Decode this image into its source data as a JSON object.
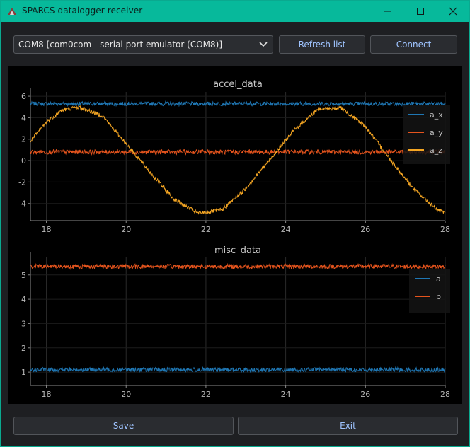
{
  "window": {
    "title": "SPARCS datalogger receiver"
  },
  "port_select": {
    "value": "COM8 [com0com - serial port emulator (COM8)]"
  },
  "buttons": {
    "refresh": "Refresh list",
    "connect": "Connect",
    "save": "Save",
    "exit": "Exit"
  },
  "colors": {
    "accent": "#07b99b",
    "a_x": "#1f77b4",
    "a_y": "#e5541d",
    "a_z": "#f5a623",
    "a": "#1f77b4",
    "b": "#e5541d"
  },
  "chart_data": [
    {
      "type": "line",
      "title": "accel_data",
      "xlim": [
        17.6,
        28.0
      ],
      "ylim": [
        -5.6,
        6.4
      ],
      "xticks": [
        "18",
        "20",
        "22",
        "24",
        "26",
        "28"
      ],
      "yticks": [
        "6",
        "4",
        "2",
        "0",
        "-2",
        "-4"
      ],
      "legend_position": "top-right",
      "grid": true,
      "series": [
        {
          "name": "a_x",
          "x": [
            17.6,
            18,
            20,
            22,
            24,
            26,
            28
          ],
          "y": [
            5.3,
            5.3,
            5.3,
            5.3,
            5.3,
            5.3,
            5.3
          ]
        },
        {
          "name": "a_y",
          "x": [
            17.6,
            18,
            20,
            22,
            24,
            26,
            28
          ],
          "y": [
            0.8,
            0.8,
            0.8,
            0.8,
            0.8,
            0.8,
            0.8
          ]
        },
        {
          "name": "a_z",
          "x": [
            17.6,
            18.0,
            18.4,
            18.8,
            19.4,
            20.0,
            20.6,
            21.2,
            21.8,
            22.4,
            23.0,
            23.6,
            24.2,
            24.8,
            25.4,
            26.0,
            26.6,
            27.2,
            27.8,
            28.0
          ],
          "y": [
            1.8,
            3.6,
            4.7,
            5.0,
            4.2,
            1.6,
            -1.1,
            -3.6,
            -4.9,
            -4.6,
            -2.6,
            0.1,
            2.8,
            4.8,
            4.9,
            3.2,
            0.2,
            -2.6,
            -4.6,
            -4.9
          ]
        }
      ]
    },
    {
      "type": "line",
      "title": "misc_data",
      "xlim": [
        17.6,
        28.0
      ],
      "ylim": [
        0.45,
        5.75
      ],
      "xticks": [
        "18",
        "20",
        "22",
        "24",
        "26",
        "28"
      ],
      "yticks": [
        "5",
        "4",
        "3",
        "2",
        "1"
      ],
      "legend_position": "top-right",
      "grid": true,
      "series": [
        {
          "name": "a",
          "x": [
            17.6,
            18,
            20,
            22,
            24,
            26,
            28
          ],
          "y": [
            1.1,
            1.1,
            1.1,
            1.1,
            1.1,
            1.1,
            1.1
          ]
        },
        {
          "name": "b",
          "x": [
            17.6,
            18,
            20,
            22,
            24,
            26,
            28
          ],
          "y": [
            5.35,
            5.35,
            5.35,
            5.35,
            5.35,
            5.35,
            5.35
          ]
        }
      ]
    }
  ]
}
